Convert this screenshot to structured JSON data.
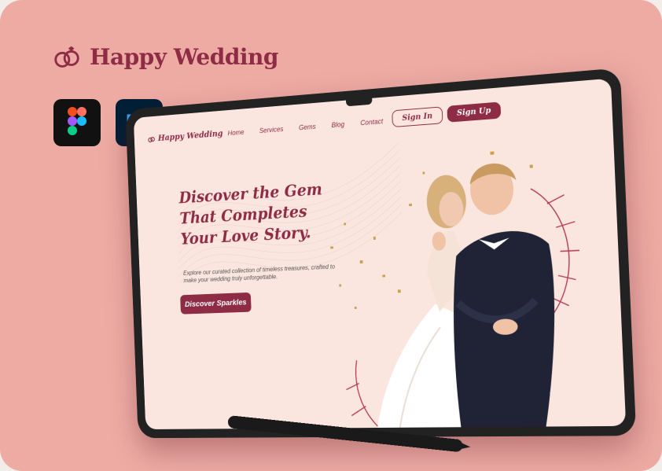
{
  "brand": {
    "title": "Happy Wedding",
    "icon": "rings-icon",
    "color": "#8e2c45"
  },
  "apps": [
    {
      "name": "Figma",
      "icon": "figma-icon"
    },
    {
      "name": "Photoshop",
      "icon": "photoshop-icon",
      "label": "Ps"
    }
  ],
  "site": {
    "logo": "Happy Wedding",
    "nav": [
      "Home",
      "Services",
      "Gems",
      "Blog",
      "Contact"
    ],
    "signin_label": "Sign In",
    "signup_label": "Sign Up",
    "hero_title": "Discover the Gem That Completes Your Love Story.",
    "hero_description": "Explore our curated collection of timeless treasures, crafted to make your wedding truly unforgettable.",
    "hero_button": "Discover Sparkles"
  },
  "colors": {
    "background": "#eeaba4",
    "accent": "#8e2c45",
    "screen": "#fbe6df"
  }
}
